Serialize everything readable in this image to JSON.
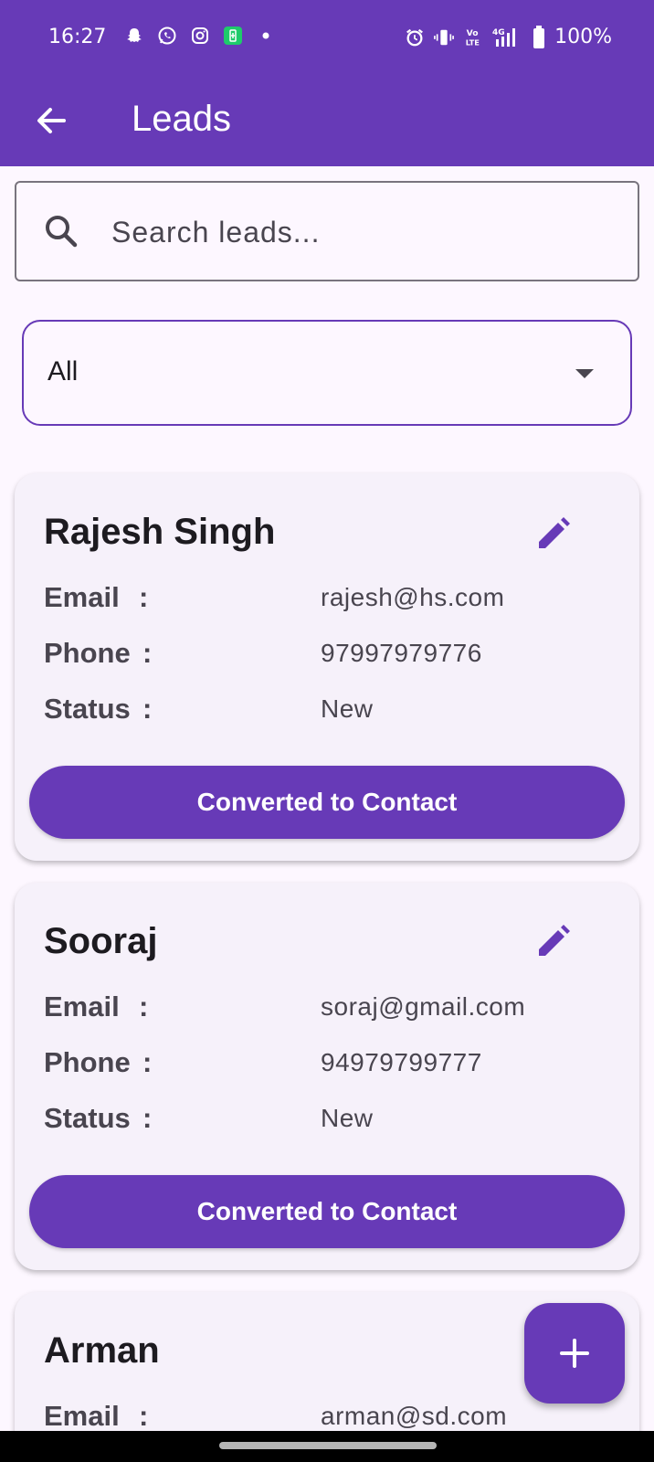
{
  "status_bar": {
    "time": "16:27",
    "left_icons": [
      "snapchat-icon",
      "whatsapp-icon",
      "instagram-icon",
      "battery-saver-icon",
      "dot-icon"
    ],
    "right_icons": [
      "alarm-icon",
      "vibrate-icon",
      "volte-icon",
      "signal-4g-icon",
      "battery-icon"
    ],
    "battery": "100%"
  },
  "app_bar": {
    "title": "Leads",
    "back_icon": "arrow-back-icon",
    "color": "#673ab7"
  },
  "search": {
    "placeholder": "Search leads...",
    "value": "",
    "icon": "search-icon"
  },
  "filter": {
    "selected": "All",
    "icon": "dropdown-arrow-icon"
  },
  "labels": {
    "email": "Email",
    "phone": "Phone",
    "status": "Status",
    "colon": ":"
  },
  "leads": [
    {
      "name": "Rajesh Singh",
      "email": "rajesh@hs.com",
      "phone": "97997979776",
      "status": "New",
      "action": "Converted to Contact"
    },
    {
      "name": "Sooraj",
      "email": "soraj@gmail.com",
      "phone": "94979799777",
      "status": "New",
      "action": "Converted to Contact"
    },
    {
      "name": "Arman",
      "email": "arman@sd.com"
    }
  ],
  "fab": {
    "icon": "plus-icon"
  },
  "colors": {
    "accent": "#673ab7",
    "card": "#f6f1fa",
    "background": "#fdf7ff"
  }
}
